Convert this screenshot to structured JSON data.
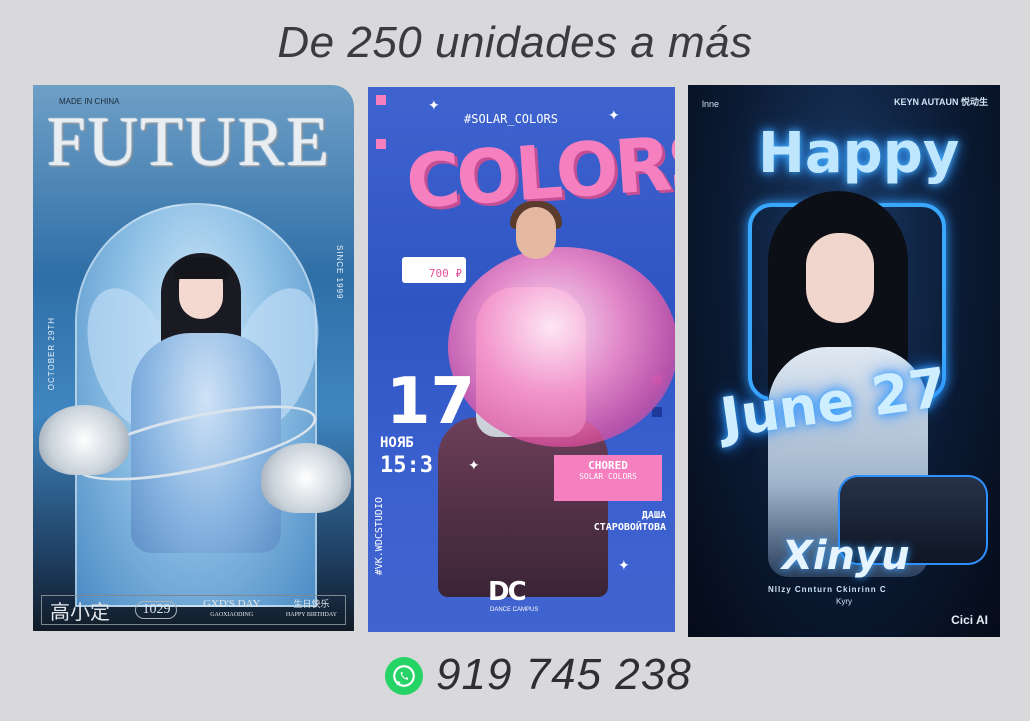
{
  "heading": "De 250 unidades a más",
  "posters": {
    "future": {
      "title": "FUTURE",
      "made_in": "MADE IN CHINA",
      "since": "SINCE 1999",
      "date_vertical": "OCTOBER 29TH",
      "cn_name": "高小定",
      "number": "1029",
      "day_title": "GXD'S DAY",
      "day_sub": "GAOXIAODING",
      "bday_cn": "生日快乐",
      "bday_en": "HAPPY BIRTHDAY"
    },
    "colors": {
      "tag": "#SOLAR_COLORS",
      "title": "COLORS",
      "price": "700 ₽",
      "day": "17",
      "month": "НОЯБ",
      "time": "15:3",
      "chored_title": "CHORED",
      "chored_sub": "SOLAR COLORS",
      "name_1": "ДАША",
      "name_2": "СТАРОВОЙТОВА",
      "vk": "#VK.WDCSTUDIO",
      "logo": "DC",
      "logo_sub": "DANCE CAMPUS"
    },
    "happy": {
      "title": "Happy",
      "date": "June 27",
      "name": "Xinyu",
      "subtitle": "Nllzy Cnnturn Ckinrinn C",
      "subtitle2": "Kyry",
      "brand": "Cici AI",
      "top_left": "lnne",
      "top_right": "KEYN AUTAUN  悦动生"
    }
  },
  "contact": {
    "icon": "whatsapp-icon",
    "phone": "919 745 238"
  },
  "colors": {
    "background": "#d9d9db",
    "whatsapp": "#25d366",
    "pink": "#f57fbf",
    "neon_blue": "#3aa7ff"
  }
}
